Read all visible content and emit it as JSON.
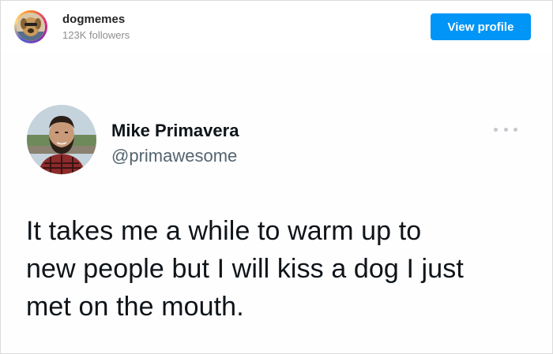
{
  "header": {
    "account_name": "dogmemes",
    "followers": "123K followers",
    "view_profile_label": "View profile",
    "avatar_icon": "dog-avatar-icon",
    "accent_color": "#0095f6"
  },
  "tweet": {
    "author_name": "Mike Primavera",
    "author_handle": "@primawesome",
    "more_icon": "more-options-icon",
    "text_lines": [
      "It takes me a while to warm up to",
      "new people but I will kiss a dog I just",
      "met on the mouth."
    ]
  }
}
